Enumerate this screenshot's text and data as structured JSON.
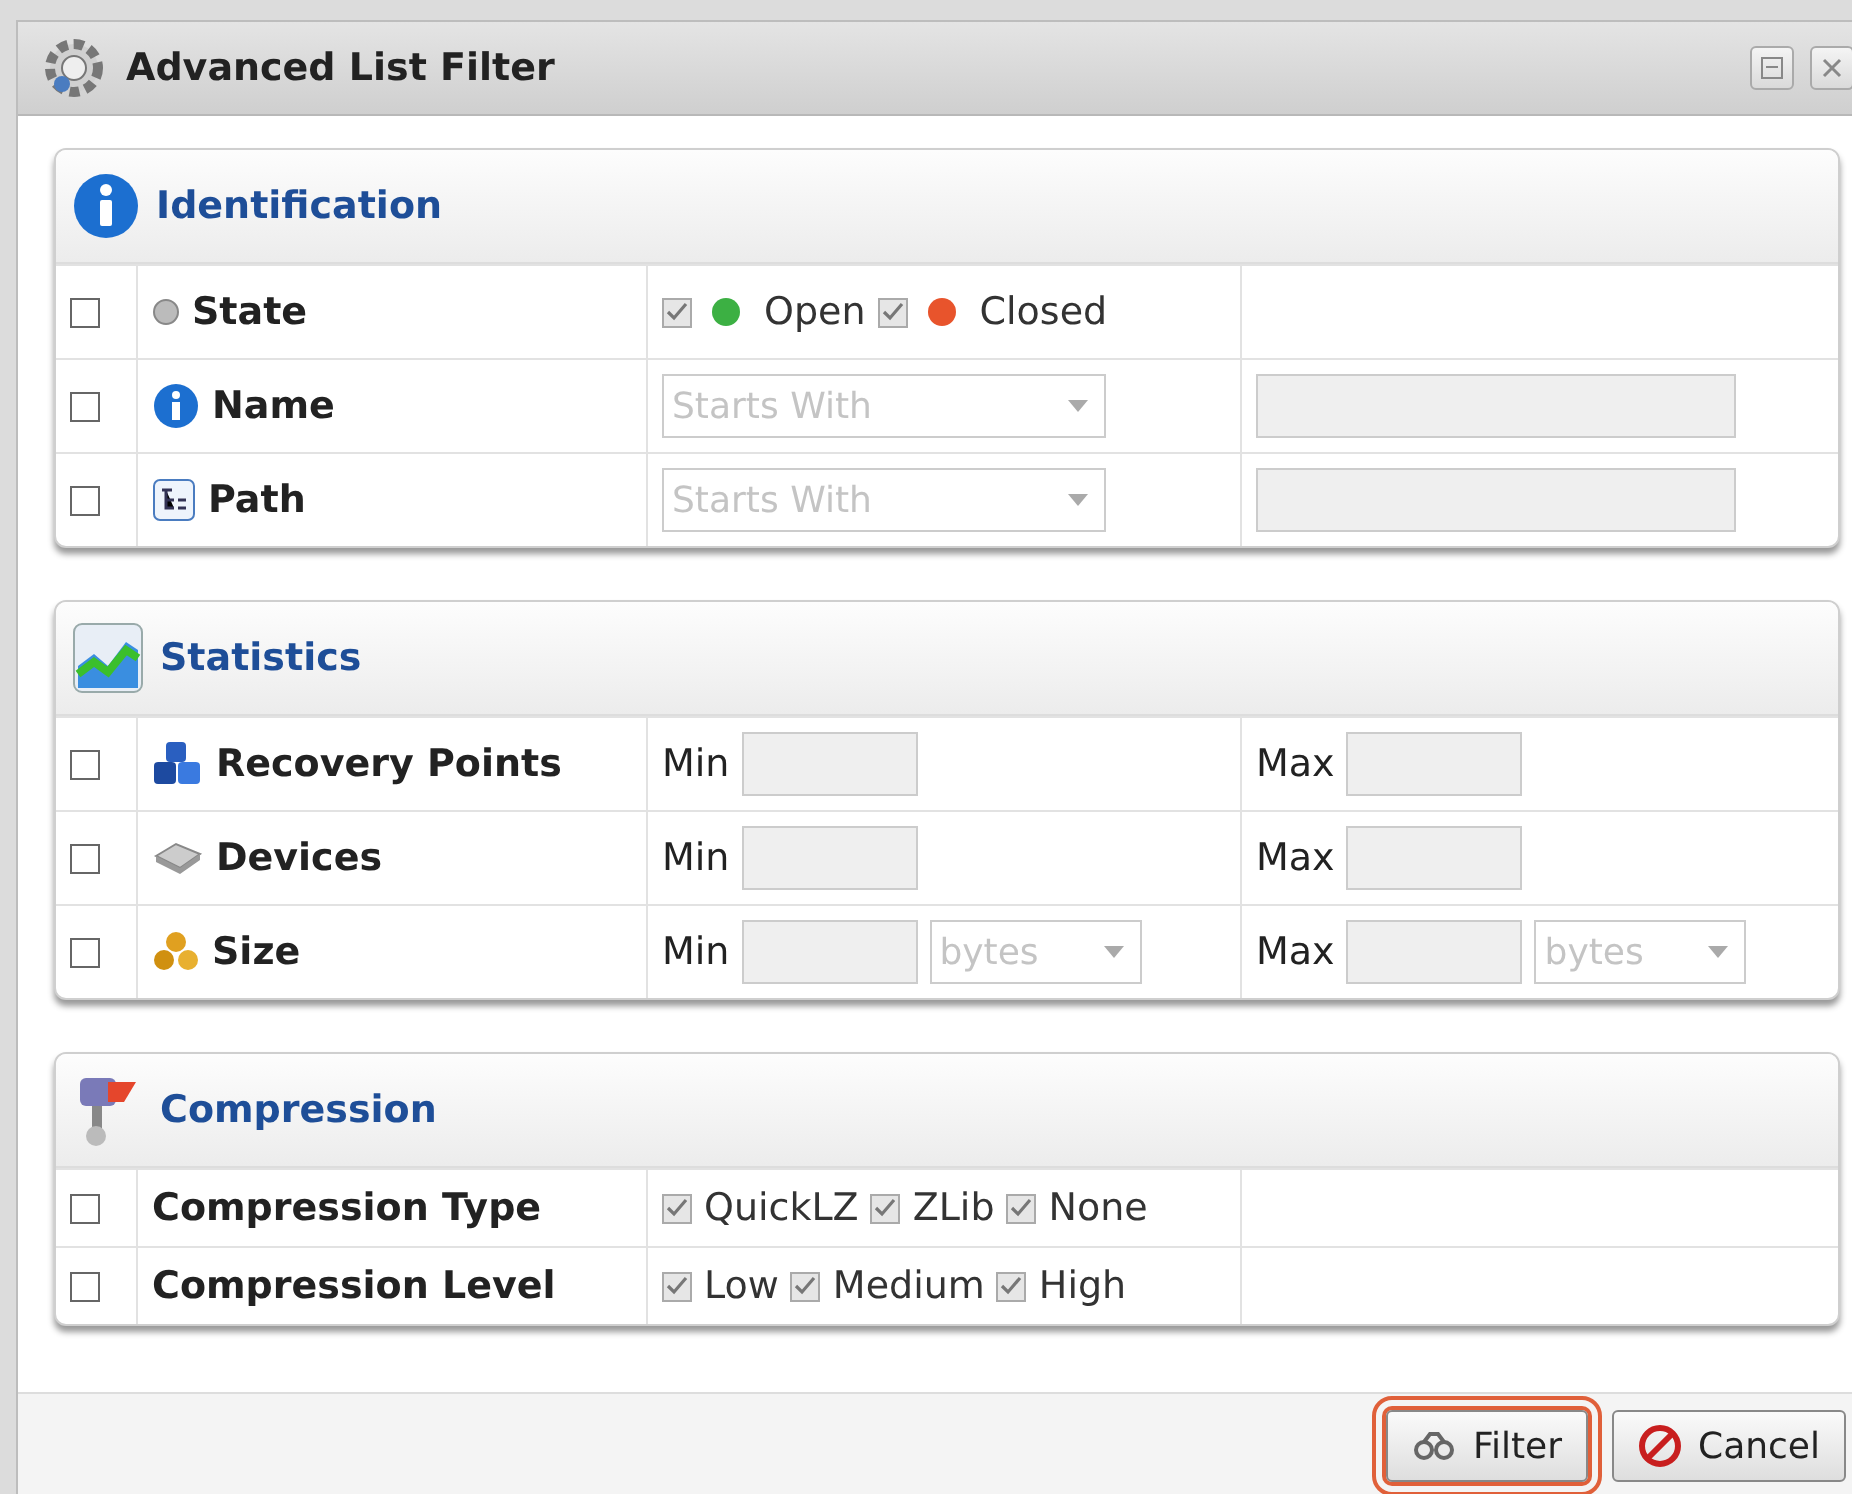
{
  "window": {
    "title": "Advanced List Filter"
  },
  "sections": [
    {
      "title": "Identification",
      "rows": [
        {
          "kind": "options",
          "label": "State",
          "checked": false,
          "options": [
            {
              "label": "Open",
              "checked": true,
              "color": "#3cb043"
            },
            {
              "label": "Closed",
              "checked": true,
              "color": "#e8542c"
            }
          ]
        },
        {
          "kind": "match",
          "label": "Name",
          "checked": false,
          "operator": "Starts With"
        },
        {
          "kind": "match",
          "label": "Path",
          "checked": false,
          "operator": "Starts With"
        }
      ]
    },
    {
      "title": "Statistics",
      "rows": [
        {
          "kind": "range",
          "label": "Recovery Points",
          "checked": false,
          "min_label": "Min",
          "max_label": "Max"
        },
        {
          "kind": "range",
          "label": "Devices",
          "checked": false,
          "min_label": "Min",
          "max_label": "Max"
        },
        {
          "kind": "range",
          "label": "Size",
          "checked": false,
          "min_label": "Min",
          "max_label": "Max",
          "unit": "bytes",
          "max_unit": "bytes"
        }
      ]
    },
    {
      "title": "Compression",
      "rows": [
        {
          "kind": "options",
          "label": "Compression Type",
          "checked": false,
          "options": [
            {
              "label": "QuickLZ",
              "checked": true
            },
            {
              "label": "ZLib",
              "checked": true
            },
            {
              "label": "None",
              "checked": true
            }
          ]
        },
        {
          "kind": "options",
          "label": "Compression Level",
          "checked": false,
          "options": [
            {
              "label": "Low",
              "checked": true
            },
            {
              "label": "Medium",
              "checked": true
            },
            {
              "label": "High",
              "checked": true
            }
          ]
        }
      ]
    }
  ],
  "buttons": [
    {
      "label": "Filter",
      "kind": "filter",
      "highlighted": true
    },
    {
      "label": "Cancel",
      "kind": "cancel",
      "highlighted": false
    }
  ]
}
